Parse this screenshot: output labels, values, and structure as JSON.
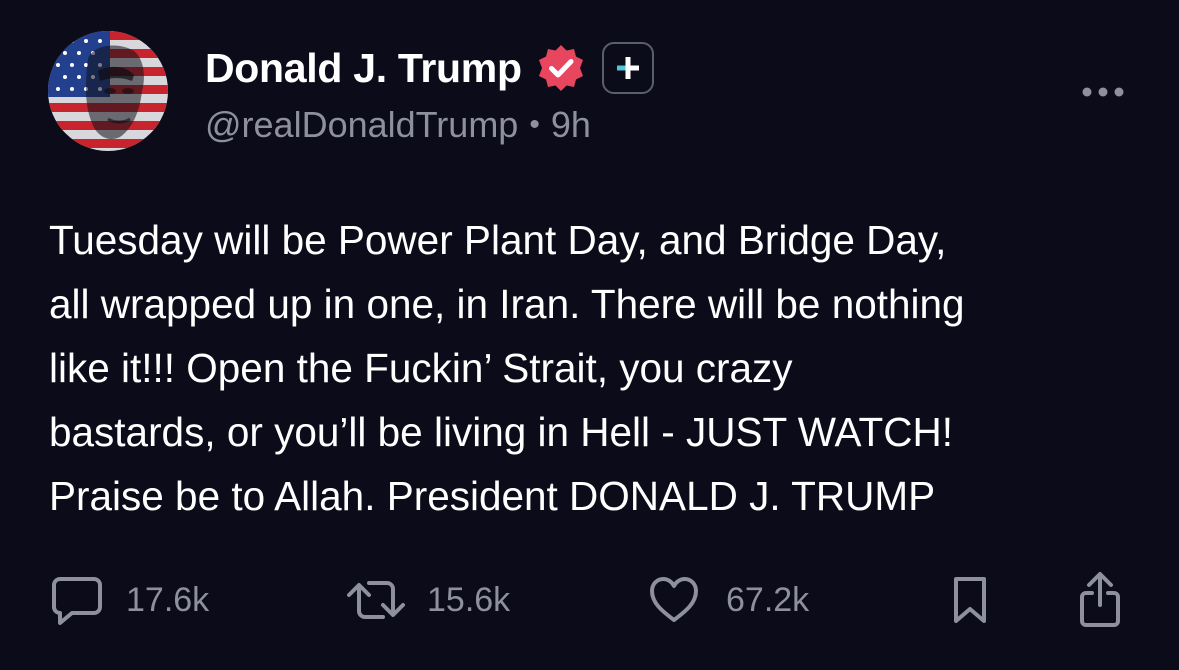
{
  "author": {
    "display_name": "Donald J. Trump",
    "handle": "@realDonaldTrump",
    "separator": "•",
    "time": "9h",
    "avatar_icon": "flag-portrait-avatar",
    "verified_icon": "verified-badge-icon",
    "verified_color": "#e8455f",
    "follow_icon": "plus-icon",
    "follow_icon_color": "#4fc6d3"
  },
  "post": {
    "lines": [
      "Tuesday will be Power Plant Day, and Bridge Day,",
      "all wrapped up in one, in Iran. There will be nothing",
      "like it!!! Open the Fuckin’ Strait, you crazy",
      "bastards, or you’ll be living in Hell - JUST WATCH!",
      "Praise be to Allah. President DONALD J. TRUMP"
    ]
  },
  "actions": {
    "replies": {
      "icon": "comment-icon",
      "count": "17.6k"
    },
    "reposts": {
      "icon": "repost-icon",
      "count": "15.6k"
    },
    "likes": {
      "icon": "heart-icon",
      "count": "67.2k"
    },
    "bookmark": {
      "icon": "bookmark-icon"
    },
    "share": {
      "icon": "share-icon"
    }
  },
  "colors": {
    "background": "#0b0b1a",
    "text_primary": "#ffffff",
    "text_secondary": "#8e919c"
  }
}
